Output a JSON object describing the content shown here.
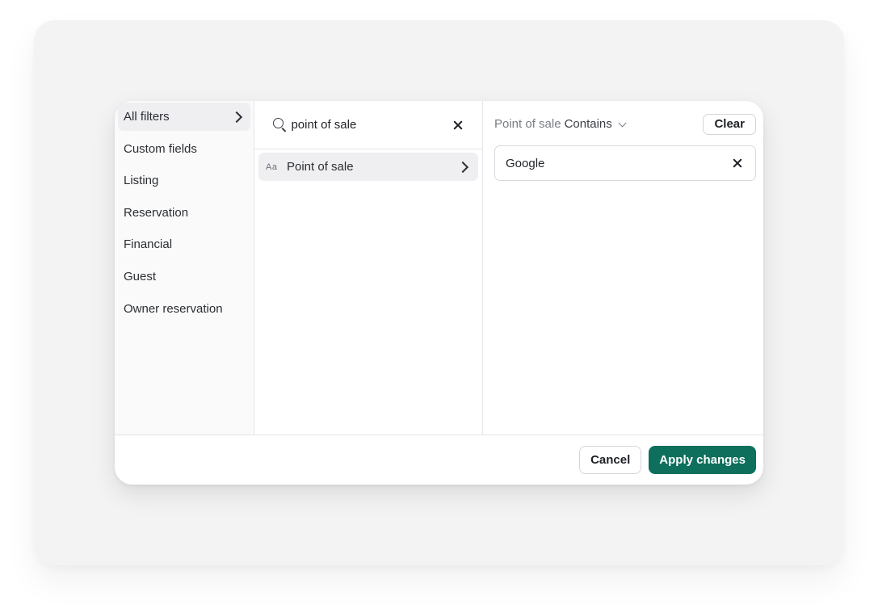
{
  "categories": [
    {
      "label": "All filters",
      "active": true
    },
    {
      "label": "Custom fields"
    },
    {
      "label": "Listing"
    },
    {
      "label": "Reservation"
    },
    {
      "label": "Financial"
    },
    {
      "label": "Guest"
    },
    {
      "label": "Owner reservation"
    }
  ],
  "search": {
    "value": "point of sale",
    "icon": "search-icon",
    "clear_icon": "close-icon"
  },
  "fields": [
    {
      "type_icon": "Aa",
      "label": "Point of sale"
    }
  ],
  "condition": {
    "field": "Point of sale",
    "operator": "Contains",
    "clear_label": "Clear",
    "value": "Google"
  },
  "footer": {
    "cancel_label": "Cancel",
    "apply_label": "Apply changes"
  },
  "colors": {
    "accent": "#0d6f5c",
    "backdrop": "#f3f3f4"
  }
}
